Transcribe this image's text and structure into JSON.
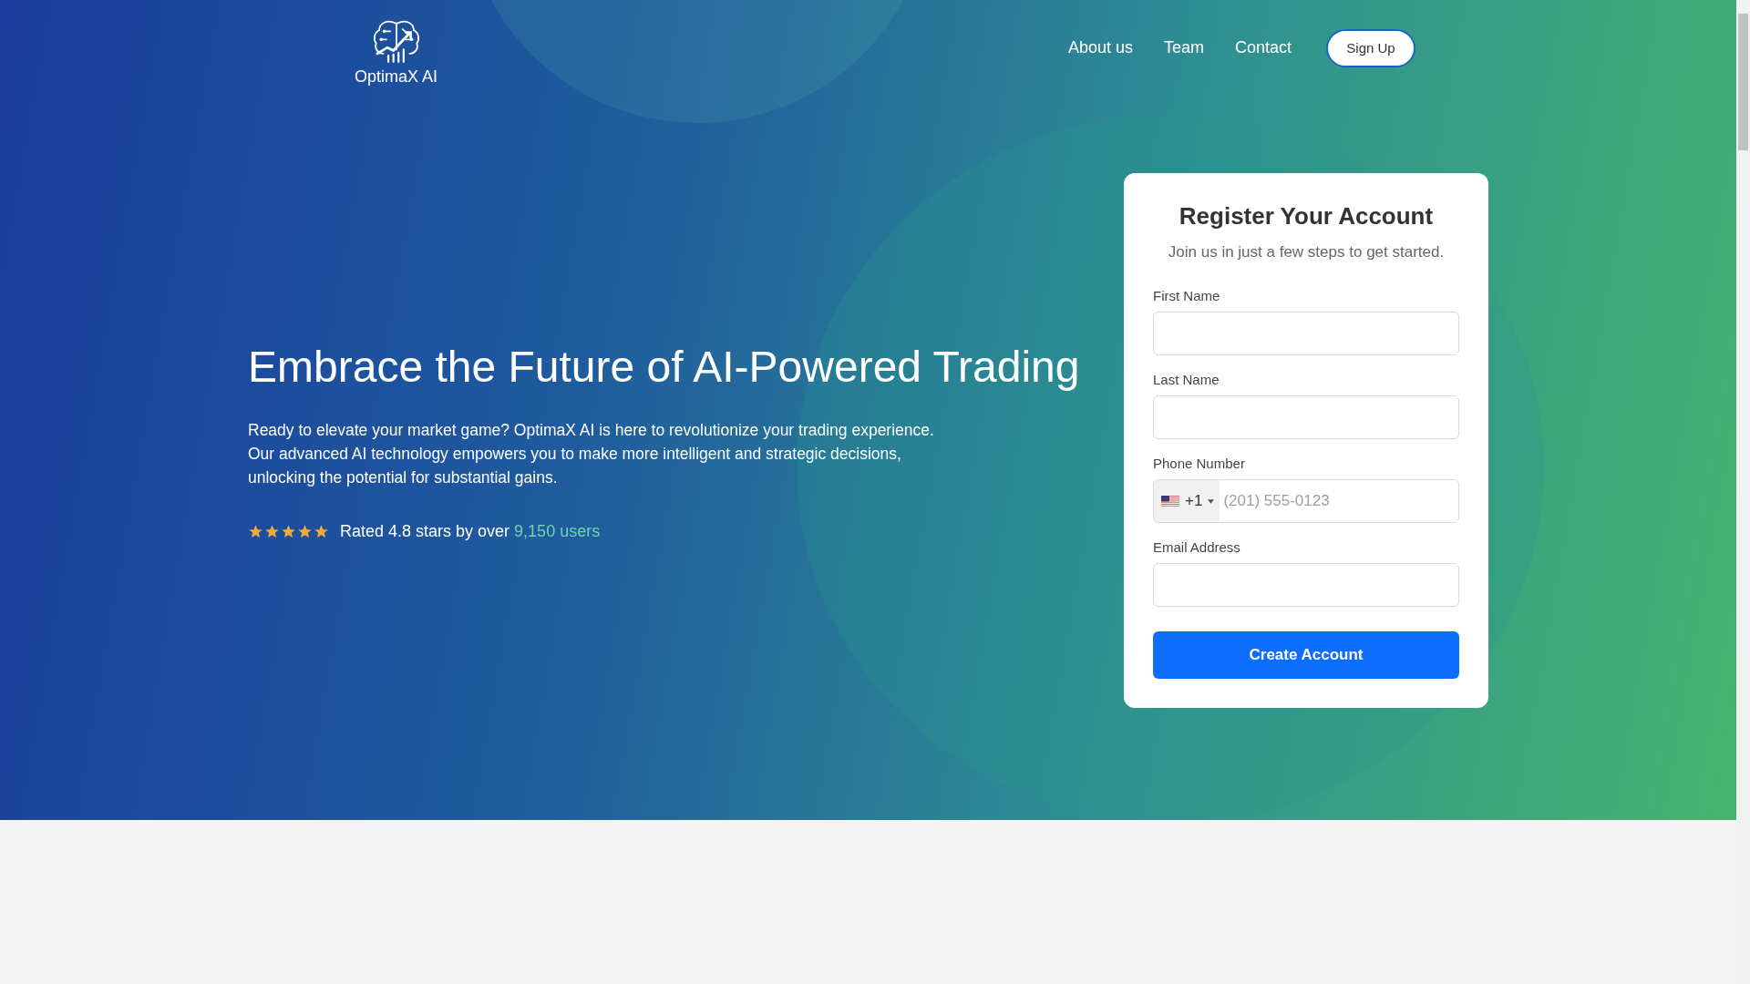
{
  "header": {
    "logo_text": "OptimaX AI",
    "links": [
      {
        "label": "About us"
      },
      {
        "label": "Team"
      },
      {
        "label": "Contact"
      }
    ],
    "signup": "Sign Up"
  },
  "hero": {
    "heading": "Embrace the Future of AI-Powered Trading",
    "paragraph": "Ready to elevate your market game? OptimaX AI is here to revolutionize your trading experience. Our advanced AI technology empowers you to make more intelligent and strategic decisions, unlocking the potential for substantial gains.",
    "rating": {
      "stars": 5,
      "text": "Rated 4.8 stars by over",
      "highlight": "9,150 users"
    }
  },
  "form": {
    "title": "Register Your Account",
    "subtitle": "Join us in just a few steps to get started.",
    "fields": [
      {
        "kind": "text",
        "label": "First Name"
      },
      {
        "kind": "text",
        "label": "Last Name"
      },
      {
        "kind": "phone",
        "label": "Phone Number",
        "code": "+1",
        "placeholder": "(201) 555-0123"
      },
      {
        "kind": "email",
        "label": "Email Address"
      }
    ],
    "submit": "Create Account"
  }
}
